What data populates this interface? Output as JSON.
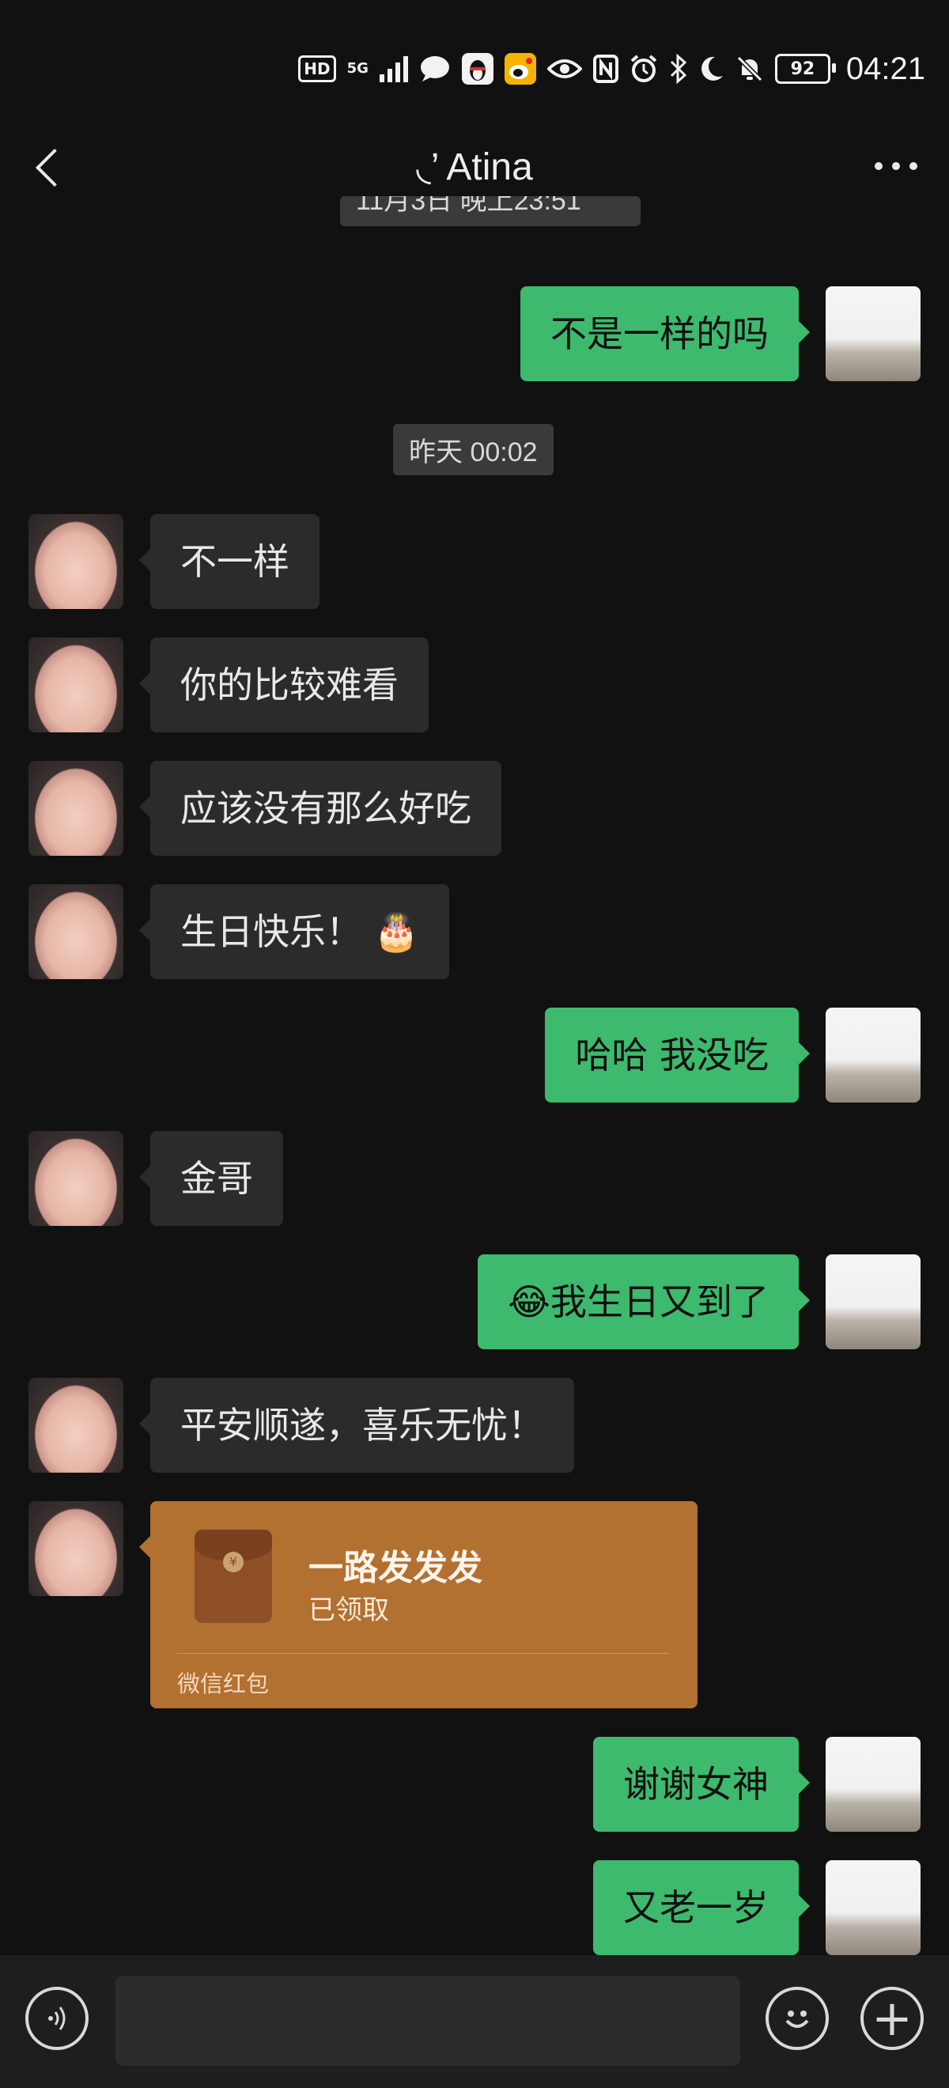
{
  "status_bar": {
    "hd": "HD",
    "network": "5G",
    "battery": "92",
    "time": "04:21"
  },
  "header": {
    "title": "◟’ Atina"
  },
  "timestamps": {
    "partial_top": "11月3日 晚上23:51",
    "yesterday": "昨天 00:02"
  },
  "messages": [
    {
      "from": "me",
      "text": "不是一样的吗"
    },
    {
      "from": "them",
      "text": "不一样"
    },
    {
      "from": "them",
      "text": "你的比较难看"
    },
    {
      "from": "them",
      "text": "应该没有那么好吃"
    },
    {
      "from": "them",
      "text": "生日快乐！ 🎂"
    },
    {
      "from": "me",
      "text": "哈哈 我没吃"
    },
    {
      "from": "them",
      "text": "金哥"
    },
    {
      "from": "me",
      "text": "😂我生日又到了"
    },
    {
      "from": "them",
      "text": "平安顺遂，喜乐无忧！"
    },
    {
      "from": "me",
      "text": "谢谢女神"
    },
    {
      "from": "me",
      "text": "又老一岁"
    }
  ],
  "red_packet": {
    "title": "一路发发发",
    "status": "已领取",
    "footer": "微信红包"
  },
  "input_bar": {
    "placeholder": "",
    "plus": "+"
  }
}
